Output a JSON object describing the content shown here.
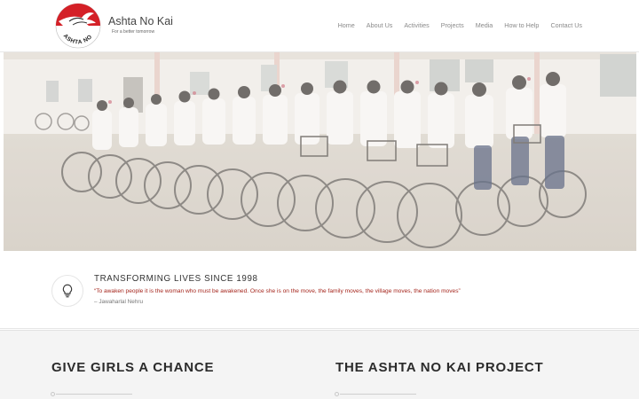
{
  "brand": {
    "name": "Ashta No Kai",
    "tagline": "For a better tomorrow",
    "logo_text": "ASHTA NO KAI",
    "logo_color": "#d42027"
  },
  "nav": {
    "items": [
      {
        "label": "Home"
      },
      {
        "label": "About Us"
      },
      {
        "label": "Activities"
      },
      {
        "label": "Projects"
      },
      {
        "label": "Media"
      },
      {
        "label": "How to Help"
      },
      {
        "label": "Contact Us"
      }
    ]
  },
  "intro": {
    "icon": "lightbulb-icon",
    "title": "TRANSFORMING LIVES SINCE 1998",
    "quote": "“To awaken people it is the woman who must be awakened. Once she is on the move, the family moves, the village moves, the nation moves”",
    "attribution": "– Jawaharlal Nehru",
    "quote_color": "#a5261d"
  },
  "sections": {
    "left_title": "GIVE GIRLS A CHANCE",
    "right_title": "THE ASHTA NO KAI PROJECT"
  }
}
